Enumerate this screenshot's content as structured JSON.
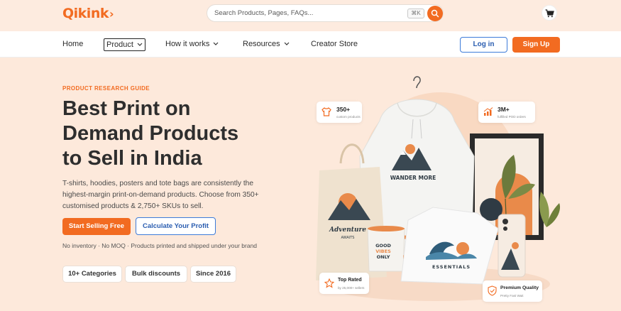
{
  "brand": {
    "name": "Qikink",
    "accent": "#f26b21",
    "link_blue": "#2a5db0"
  },
  "search": {
    "placeholder": "Search Products, Pages, FAQs...",
    "shortcut": "⌘K",
    "icon": "search-icon"
  },
  "header": {
    "cart_icon": "cart-icon"
  },
  "nav": {
    "items": [
      {
        "label": "Home"
      },
      {
        "label": "Product",
        "has_dropdown": true
      },
      {
        "label": "How it works",
        "has_dropdown": true
      },
      {
        "label": "Resources",
        "has_dropdown": true
      },
      {
        "label": "Creator Store"
      }
    ],
    "login_label": "Log in",
    "signup_label": "Sign Up"
  },
  "hero": {
    "eyebrow": "PRODUCT RESEARCH GUIDE",
    "title_lines": [
      "Best Print on",
      "Demand Products",
      "to Sell in India"
    ],
    "description": "T-shirts, hoodies, posters and tote bags are consistently the highest-margin print-on-demand products. Choose from 350+ customised products & 2,750+ SKUs to sell.",
    "primary_cta": "Start Selling Free",
    "secondary_cta": "Calculate Your Profit",
    "note": "No inventory · No MOQ · Products printed and shipped under your brand",
    "pills": [
      "10+ Categories",
      "Bulk discounts",
      "Since 2016"
    ]
  },
  "illustration": {
    "cards": [
      {
        "big": "350+",
        "small": "custom products",
        "icon": "tshirt-icon"
      },
      {
        "big": "3M+",
        "small": "fulfilled POD orders",
        "icon": "growth-chart-icon"
      },
      {
        "big": "Top Rated",
        "small": "by 25,000+ sellers",
        "icon": "star-icon"
      },
      {
        "big": "Premium Quality",
        "small": "Pretty Fast Wait",
        "icon": "shield-icon"
      }
    ],
    "hoodie_text": "WANDER MORE",
    "tote_text_1": "Adventure",
    "tote_text_2": "AWAITS",
    "mug_text": [
      "GOOD",
      "VIBES",
      "ONLY"
    ],
    "tee_text": "ESSENTIALS"
  }
}
